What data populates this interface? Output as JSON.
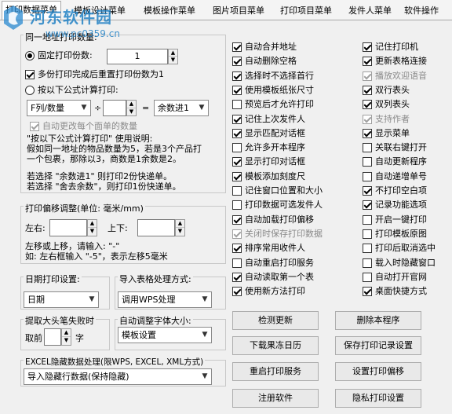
{
  "tabs": [
    "打印数据菜单",
    "模板设计菜单",
    "模板操作菜单",
    "图片项目菜单",
    "打印项目菜单",
    "发件人菜单",
    "软件操作"
  ],
  "watermark": {
    "title": "河东软件园",
    "url": "www.pc0359.cn"
  },
  "same_address": {
    "header": "同一地址打印数量:",
    "fixed_label": "固定打印份数:",
    "fixed_value": "1",
    "reset_label": "多份打印完成后重置打印份数为1",
    "formula_label": "按以下公式计算打印:",
    "col_select": "F列/数量",
    "div_op": "÷",
    "div_value": "",
    "eq_op": "=",
    "round_select": "余数进1",
    "auto_label": "自动更改每个面单的数量",
    "desc": [
      "\"按以下公式计算打印\" 使用说明:",
      "假如同一地址的物品数量为5，若是3个产品打",
      "一个包裹，那除以3，商数是1余数是2。",
      "",
      "若选择 \"余数进1\" 则打印2份快递单。",
      "若选择 \"舍去余数\"，则打印1份快递单。"
    ]
  },
  "offset": {
    "header": "打印偏移调整(单位: 毫米/mm)",
    "lr_label": "左右:",
    "ud_label": "上下:",
    "help1": "左移或上移，请输入: \"-\"",
    "help2": "如: 左右框输入 \"-5\"，表示左移5毫米"
  },
  "date": {
    "label": "日期打印设置:",
    "value": "日期"
  },
  "import": {
    "label": "导入表格处理方式:",
    "value": "调用WPS处理"
  },
  "upper": {
    "label": "提取大头笔失败时",
    "prefix": "取前",
    "suffix": "字"
  },
  "font": {
    "label": "自动调整字体大小:",
    "value": "模板设置"
  },
  "excel": {
    "label": "EXCEL隐藏数据处理(限WPS, EXCEL, XML方式)",
    "value": "导入隐藏行数据(保持隐藏)"
  },
  "mid_checks": [
    {
      "label": "自动合并地址",
      "checked": true,
      "disabled": false
    },
    {
      "label": "自动删除空格",
      "checked": true,
      "disabled": false
    },
    {
      "label": "选择时不选择首行",
      "checked": true,
      "disabled": false
    },
    {
      "label": "使用模板纸张尺寸",
      "checked": true,
      "disabled": false
    },
    {
      "label": "预览后才允许打印",
      "checked": false,
      "disabled": false
    },
    {
      "label": "记住上次发件人",
      "checked": true,
      "disabled": false
    },
    {
      "label": "显示匹配对话框",
      "checked": true,
      "disabled": false
    },
    {
      "label": "允许多开本程序",
      "checked": false,
      "disabled": false
    },
    {
      "label": "显示打印对话框",
      "checked": true,
      "disabled": false
    },
    {
      "label": "模板添加刻度尺",
      "checked": true,
      "disabled": false
    },
    {
      "label": "记住窗口位置和大小",
      "checked": false,
      "disabled": false
    },
    {
      "label": "打印数据可选发件人",
      "checked": false,
      "disabled": false
    },
    {
      "label": "自动加载打印偏移",
      "checked": true,
      "disabled": false
    },
    {
      "label": "关闭时保存打印数据",
      "checked": true,
      "disabled": true
    },
    {
      "label": "排序常用收件人",
      "checked": true,
      "disabled": false
    },
    {
      "label": "自动重启打印服务",
      "checked": false,
      "disabled": false
    },
    {
      "label": "自动读取第一个表",
      "checked": true,
      "disabled": false
    },
    {
      "label": "使用新方法打印",
      "checked": true,
      "disabled": false
    }
  ],
  "right_checks": [
    {
      "label": "记住打印机",
      "checked": true,
      "disabled": false
    },
    {
      "label": "更新表格连接",
      "checked": true,
      "disabled": false
    },
    {
      "label": "播放欢迎语音",
      "checked": true,
      "disabled": true
    },
    {
      "label": "双行表头",
      "checked": true,
      "disabled": false
    },
    {
      "label": "双列表头",
      "checked": true,
      "disabled": false
    },
    {
      "label": "支持作者",
      "checked": true,
      "disabled": true
    },
    {
      "label": "显示菜单",
      "checked": true,
      "disabled": false
    },
    {
      "label": "关联右键打开",
      "checked": false,
      "disabled": false
    },
    {
      "label": "自动更新程序",
      "checked": false,
      "disabled": false
    },
    {
      "label": "自动递增单号",
      "checked": false,
      "disabled": false
    },
    {
      "label": "不打印空白项",
      "checked": true,
      "disabled": false
    },
    {
      "label": "记录功能选项",
      "checked": true,
      "disabled": false
    },
    {
      "label": "开启一键打印",
      "checked": false,
      "disabled": false
    },
    {
      "label": "打印模板原图",
      "checked": false,
      "disabled": false
    },
    {
      "label": "打印后取消选中",
      "checked": false,
      "disabled": false
    },
    {
      "label": "载入时隐藏窗口",
      "checked": false,
      "disabled": false
    },
    {
      "label": "自动打开官网",
      "checked": false,
      "disabled": false
    },
    {
      "label": "桌面快捷方式",
      "checked": true,
      "disabled": false
    }
  ],
  "buttons": [
    [
      "检测更新",
      "删除本程序"
    ],
    [
      "下载果冻日历",
      "保存打印记录设置"
    ],
    [
      "重启打印服务",
      "设置打印偏移"
    ],
    [
      "注册软件",
      "隐私打印设置"
    ]
  ]
}
